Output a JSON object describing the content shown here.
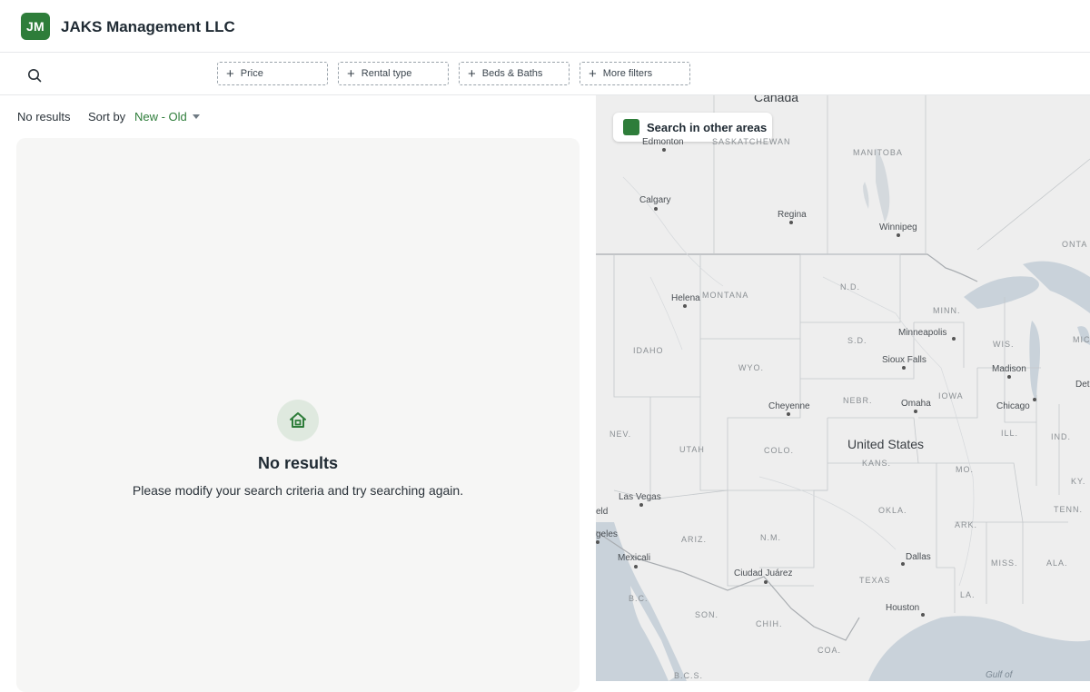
{
  "header": {
    "logo_initials": "JM",
    "company_name": "JAKS Management LLC"
  },
  "filters": {
    "search_icon": "search-icon",
    "chips": [
      {
        "label": "Price"
      },
      {
        "label": "Rental type"
      },
      {
        "label": "Beds & Baths"
      },
      {
        "label": "More filters"
      }
    ]
  },
  "listing": {
    "count_text": "No results",
    "sort_label": "Sort by",
    "sort_value": "New - Old",
    "empty_state": {
      "icon": "house-icon",
      "title": "No results",
      "message": "Please modify your search criteria and try searching again."
    }
  },
  "map": {
    "toggle_label": "Search in other areas",
    "toggle_checked": true,
    "country_labels": [
      "Canada",
      "United States"
    ],
    "city_labels": [
      "Edmonton",
      "Calgary",
      "Regina",
      "Winnipeg",
      "Helena",
      "Minneapolis",
      "Sioux Falls",
      "Madison",
      "Cheyenne",
      "Omaha",
      "Chicago",
      "Detro",
      "Las Vegas",
      "eld",
      "geles",
      "Mexicali",
      "Ciudad Juárez",
      "Dallas",
      "Houston",
      "Gulf of"
    ],
    "state_labels": [
      "SASKATCHEWAN",
      "MANITOBA",
      "ONTA",
      "MONTANA",
      "N.D.",
      "MINN.",
      "IDAHO",
      "S.D.",
      "WIS.",
      "MICH",
      "WYO.",
      "NEBR.",
      "IOWA",
      "NEV.",
      "UTAH",
      "COLO.",
      "KANS.",
      "ILL.",
      "IND.",
      "MO.",
      "KY.",
      "OKLA.",
      "TENN.",
      "ARK.",
      "ARIZ.",
      "N.M.",
      "MISS.",
      "ALA.",
      "TEXAS",
      "LA.",
      "B.C.",
      "SON.",
      "CHIH.",
      "COA.",
      "B.C.S."
    ],
    "colors": {
      "land": "#eeeeee",
      "water": "#c9d2da",
      "accent": "#2e7d3a"
    }
  }
}
